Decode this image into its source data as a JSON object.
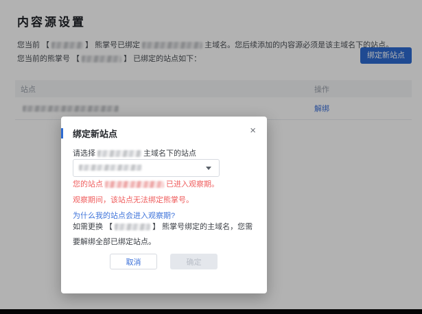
{
  "page": {
    "title": "内容源设置",
    "intro": {
      "line1_part1": "您当前 【",
      "line1_part2": "】 熊掌号已绑定",
      "line1_part3": "主域名。您后续添加的内容源必须是该主域名下的站点。",
      "line2_part1": "您当前的熊掌号 【",
      "line2_part2": "】 已绑定的站点如下："
    },
    "bind_new_site_button": "绑定新站点"
  },
  "table": {
    "headers": {
      "site": "站点",
      "action": "操作"
    },
    "row": {
      "action_link": "解绑"
    }
  },
  "modal": {
    "title": "绑定新站点",
    "close_icon": "×",
    "select_label_part1": "请选择",
    "select_label_part2": "主域名下的站点",
    "error_line1_part1": "您的站点",
    "error_line1_part2": "已进入观察期。",
    "error_line2": "观察期间，该站点无法绑定熊掌号。",
    "help_link": "为什么我的站点会进入观察期?",
    "note_part1": "如需更换 【",
    "note_part2": "】 熊掌号绑定的主域名，您需要解绑全部已绑定站点。",
    "cancel_button": "取消",
    "confirm_button": "确定"
  },
  "colors": {
    "primary_blue": "#2d6bd2",
    "link_blue": "#3a6fd8",
    "error_red": "#ef5e5e",
    "overlay": "rgba(0,0,0,0.30)"
  }
}
